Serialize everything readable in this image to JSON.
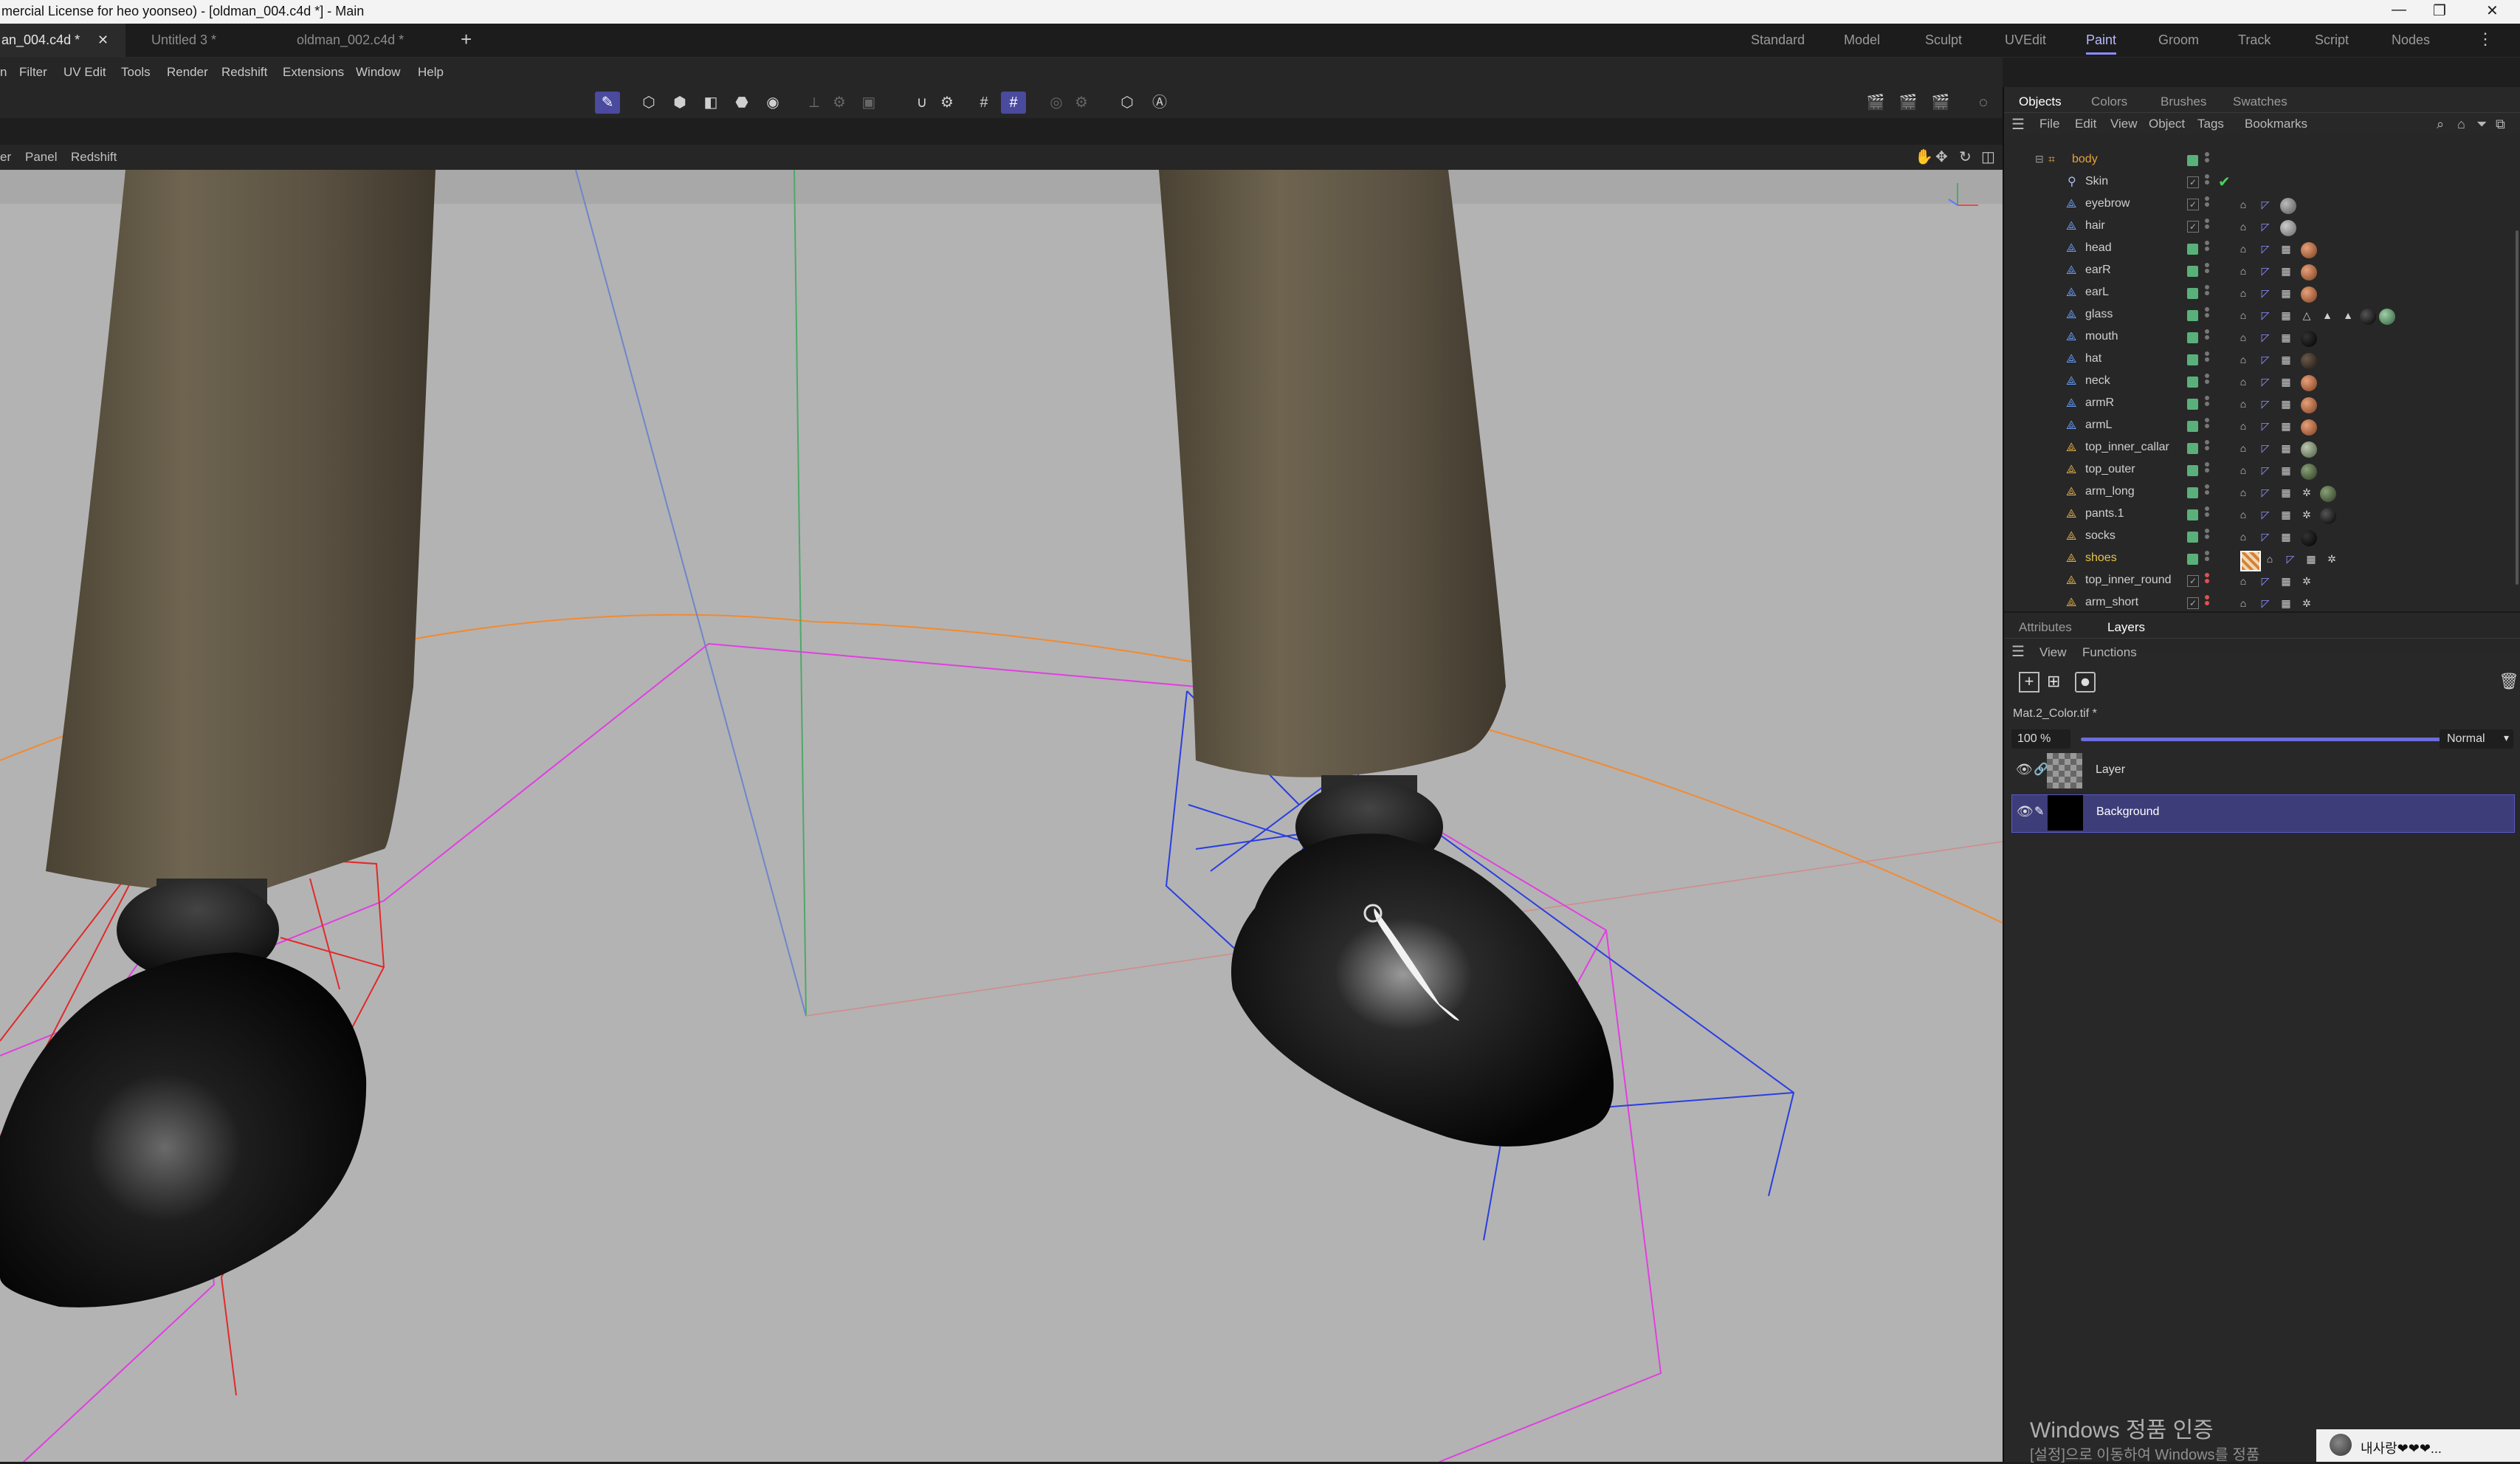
{
  "window": {
    "title": "mercial License for heo yoonseo) - [oldman_004.c4d *] - Main",
    "minimize": "—",
    "restore": "❐",
    "close": "✕"
  },
  "tabs": [
    {
      "label": "an_004.c4d *",
      "close": "✕",
      "active": true
    },
    {
      "label": "Untitled 3 *",
      "active": false
    },
    {
      "label": "oldman_002.c4d *",
      "active": false
    }
  ],
  "tab_add": "+",
  "layouts": [
    "Standard",
    "Model",
    "Sculpt",
    "UVEdit",
    "Paint",
    "Groom",
    "Track",
    "Script",
    "Nodes"
  ],
  "layout_active": "Paint",
  "layout_more": "⋮",
  "menubar": [
    "n",
    "Filter",
    "UV Edit",
    "Tools",
    "Render",
    "Redshift",
    "Extensions",
    "Window",
    "Help"
  ],
  "viewport_menu": [
    "er",
    "Panel",
    "Redshift"
  ],
  "right_panel": {
    "top_tabs": [
      "Objects",
      "Colors",
      "Brushes",
      "Swatches"
    ],
    "top_tab_active": "Objects",
    "object_menu": [
      "File",
      "Edit",
      "View",
      "Object",
      "Tags",
      "Bookmarks"
    ],
    "objects": [
      {
        "name": "body",
        "style": "orange"
      },
      {
        "name": "Skin",
        "style": "normal"
      },
      {
        "name": "eyebrow",
        "style": "normal"
      },
      {
        "name": "hair",
        "style": "normal"
      },
      {
        "name": "head",
        "style": "normal"
      },
      {
        "name": "earR",
        "style": "normal"
      },
      {
        "name": "earL",
        "style": "normal"
      },
      {
        "name": "glass",
        "style": "normal"
      },
      {
        "name": "mouth",
        "style": "normal"
      },
      {
        "name": "hat",
        "style": "normal"
      },
      {
        "name": "neck",
        "style": "normal"
      },
      {
        "name": "armR",
        "style": "normal"
      },
      {
        "name": "armL",
        "style": "normal"
      },
      {
        "name": "top_inner_callar",
        "style": "normal"
      },
      {
        "name": "top_outer",
        "style": "normal"
      },
      {
        "name": "arm_long",
        "style": "normal"
      },
      {
        "name": "pants.1",
        "style": "normal"
      },
      {
        "name": "socks",
        "style": "normal"
      },
      {
        "name": "shoes",
        "style": "yellow"
      },
      {
        "name": "top_inner_round",
        "style": "normal"
      },
      {
        "name": "arm_short",
        "style": "normal"
      }
    ],
    "attr_tabs": [
      "Attributes",
      "Layers"
    ],
    "attr_tab_active": "Layers",
    "layer_menu": [
      "View",
      "Functions"
    ],
    "texture_name": "Mat.2_Color.tif *",
    "opacity": "100 %",
    "opacity_value": 1.0,
    "blend_mode": "Normal",
    "layers": [
      {
        "name": "Layer",
        "selected": false
      },
      {
        "name": "Background",
        "selected": true
      }
    ]
  },
  "watermark": {
    "line1": "Windows 정품 인증",
    "line2": "[설정]으로 이동하여 Windows를 정품"
  },
  "notification": {
    "text": "내사랑❤❤❤..."
  },
  "colors": {
    "accent": "#8b8bff",
    "selected_row": "#3d3d7a",
    "viewport_bg": "#b3b3b3"
  }
}
